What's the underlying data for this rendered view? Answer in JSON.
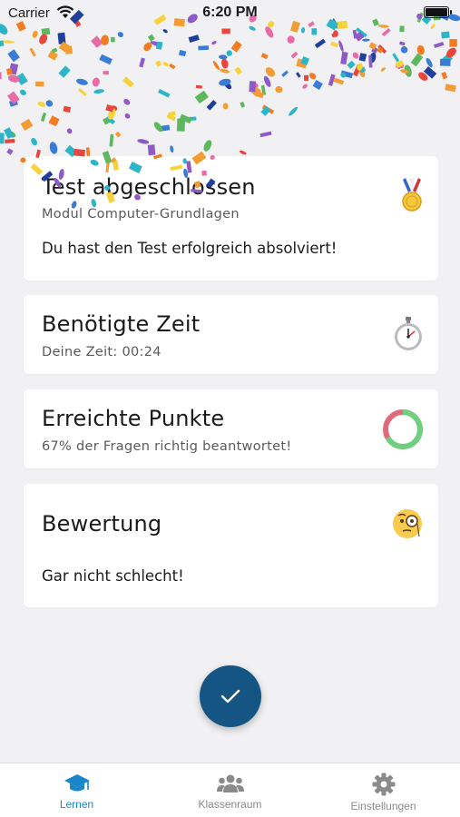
{
  "status_bar": {
    "carrier": "Carrier",
    "time": "6:20 PM"
  },
  "cards": {
    "completed": {
      "title": "Test abgeschlossen",
      "subtitle": "Modul Computer-Grundlagen",
      "body": "Du hast den Test erfolgreich absolviert!",
      "icon": "medal-icon"
    },
    "time": {
      "title": "Benötigte Zeit",
      "subtitle": "Deine Zeit: 00:24",
      "icon": "stopwatch-icon"
    },
    "points": {
      "title": "Erreichte Punkte",
      "subtitle": "67% der Fragen richtig beantwortet!",
      "icon": "progress-ring-icon",
      "correct_fraction": 0.67
    },
    "rating": {
      "title": "Bewertung",
      "body": "Gar nicht schlecht!",
      "icon": "monocle-face-icon"
    }
  },
  "fab": {
    "icon": "checkmark-icon"
  },
  "tabs": [
    {
      "label": "Lernen",
      "icon": "graduation-cap-icon",
      "active": true
    },
    {
      "label": "Klassenraum",
      "icon": "people-icon",
      "active": false
    },
    {
      "label": "Einstellungen",
      "icon": "gear-icon",
      "active": false
    }
  ],
  "colors": {
    "accent": "#1a86c9",
    "fab": "#145583",
    "ring_correct": "#6cd07c",
    "ring_wrong": "#e06a7a",
    "background": "#f1f1f3"
  }
}
